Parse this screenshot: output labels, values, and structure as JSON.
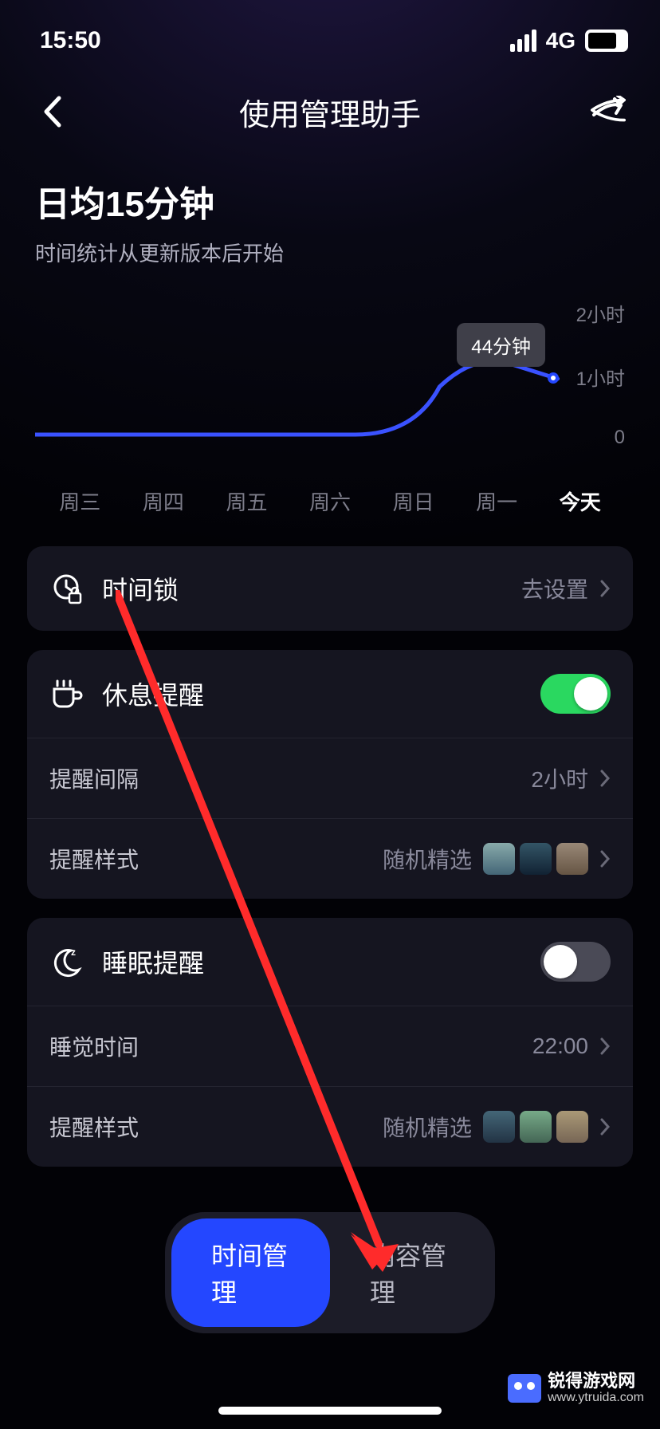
{
  "status": {
    "time": "15:50",
    "network": "4G",
    "battery": "76"
  },
  "nav": {
    "title": "使用管理助手"
  },
  "summary": {
    "title": "日均15分钟",
    "subtitle": "时间统计从更新版本后开始"
  },
  "chart_data": {
    "type": "line",
    "categories": [
      "周三",
      "周四",
      "周五",
      "周六",
      "周日",
      "周一",
      "今天"
    ],
    "values": [
      0,
      0,
      0,
      0,
      0,
      60,
      44
    ],
    "ylabels": [
      "2小时",
      "1小时",
      "0"
    ],
    "ylim": [
      0,
      120
    ],
    "xlabel": "",
    "ylabel": "",
    "tooltip": "44分钟",
    "active_index": 6
  },
  "cards": {
    "timelock": {
      "title": "时间锁",
      "action": "去设置"
    },
    "rest": {
      "title": "休息提醒",
      "toggle_on": true,
      "interval_label": "提醒间隔",
      "interval_value": "2小时",
      "style_label": "提醒样式",
      "style_value": "随机精选"
    },
    "sleep": {
      "title": "睡眠提醒",
      "toggle_on": false,
      "time_label": "睡觉时间",
      "time_value": "22:00",
      "style_label": "提醒样式",
      "style_value": "随机精选"
    }
  },
  "tabs": {
    "left": "时间管理",
    "right": "内容管理",
    "active": "left"
  },
  "watermark": {
    "name": "锐得游戏网",
    "url": "www.ytruida.com"
  }
}
